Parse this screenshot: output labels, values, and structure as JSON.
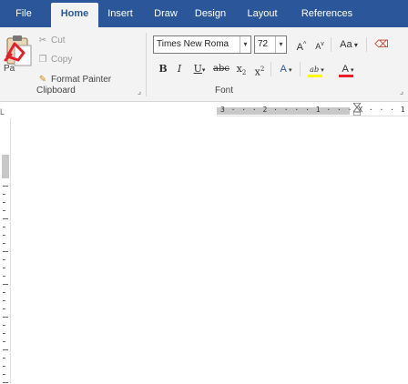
{
  "tabs": {
    "file": "File",
    "home": "Home",
    "insert": "Insert",
    "draw": "Draw",
    "design": "Design",
    "layout": "Layout",
    "references": "References"
  },
  "clipboard": {
    "paste_label": "Pa",
    "cut": "Cut",
    "copy": "Copy",
    "format_painter": "Format Painter",
    "group_label": "Clipboard"
  },
  "font": {
    "font_name": "Times New Roma",
    "font_size": "72",
    "change_case": "Aa",
    "bold": "B",
    "italic": "I",
    "underline": "U",
    "strikethrough": "abc",
    "subscript": "x",
    "superscript": "x",
    "text_effects": "A",
    "highlight": "ab",
    "font_color": "A",
    "group_label": "Font",
    "highlight_color": "#ffff00",
    "font_color_value": "#e8202a"
  },
  "ruler": {
    "horizontal_ticks": "3 · · · 2 · · · · 1 · · · X · · · 1"
  },
  "theme": {
    "accent": "#2b579a",
    "ribbon_bg": "#f3f3f3"
  }
}
